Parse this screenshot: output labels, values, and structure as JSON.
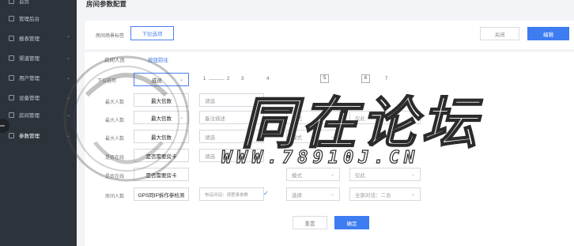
{
  "sidebar": {
    "items": [
      {
        "label": "首页",
        "arrow": ""
      },
      {
        "label": "管理后台",
        "arrow": ""
      },
      {
        "label": "报表管理",
        "arrow": "⌃"
      },
      {
        "label": "渠道管理",
        "arrow": "⌄"
      },
      {
        "label": "用户管理",
        "arrow": "⌄"
      },
      {
        "label": "设备管理",
        "arrow": "⌄"
      },
      {
        "label": "房间管理",
        "arrow": "⌄"
      },
      {
        "label": "参数管理",
        "arrow": "⌄"
      }
    ]
  },
  "page": {
    "title": "房间参数配置"
  },
  "top": {
    "label": "房间场景标签",
    "upload_label": "下拉选项",
    "cancel_label": "关闭",
    "edit_label": "编辑"
  },
  "tabs": [
    {
      "label": "房间人员"
    },
    {
      "label": "按钮前往"
    }
  ],
  "form": {
    "row1_label": "下拉选项",
    "row1_select": "成员",
    "steps": [
      "1",
      "2",
      "3",
      "4",
      "5",
      "6",
      "7"
    ],
    "row2_label": "最大人数",
    "row2_value": "最大信数",
    "row3_label": "最大人数",
    "row3_value": "最大信数",
    "row3_extra": "备注描述",
    "row4_label": "最大人数",
    "row4_value": "最大信数",
    "row5_label": "是否在线",
    "row5_value": "是否需要房卡",
    "row6_label": "是否在线",
    "row6_value": "是否需要房卡",
    "row7_label": "房间人数",
    "row7_value": "GPS同IP拆作参检测",
    "row7_extra": "电话对话：请登录参数",
    "row7_mid": "选择",
    "row7_right": "全部对话：二合",
    "placeholder_a": "请选",
    "placeholder_b": "模式",
    "placeholder_c": "仅此",
    "reset_label": "重置",
    "confirm_label": "确定"
  },
  "watermark": {
    "title": "同在论坛",
    "url": "WWW.78910J.CN"
  }
}
